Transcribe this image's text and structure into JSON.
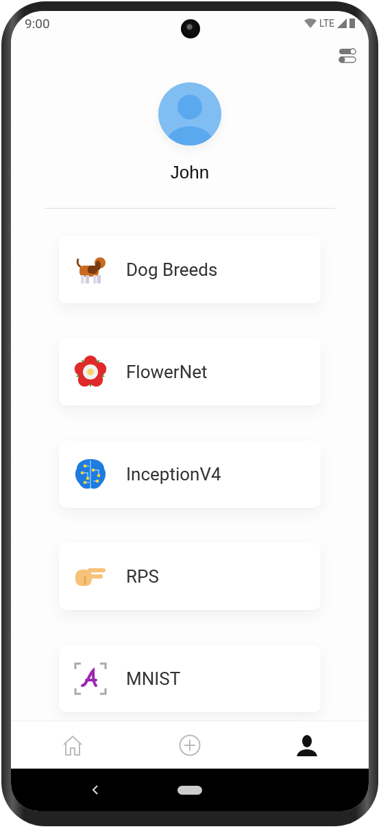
{
  "status_bar": {
    "time": "9:00",
    "network": "LTE"
  },
  "profile": {
    "name": "John"
  },
  "models": [
    {
      "name": "Dog Breeds",
      "kind": "dog"
    },
    {
      "name": "FlowerNet",
      "kind": "flower"
    },
    {
      "name": "InceptionV4",
      "kind": "brain"
    },
    {
      "name": "RPS",
      "kind": "hand"
    },
    {
      "name": "MNIST",
      "kind": "letter"
    }
  ],
  "bottom_nav": [
    {
      "kind": "home",
      "selected": false
    },
    {
      "kind": "add",
      "selected": false
    },
    {
      "kind": "profile",
      "selected": true
    }
  ]
}
